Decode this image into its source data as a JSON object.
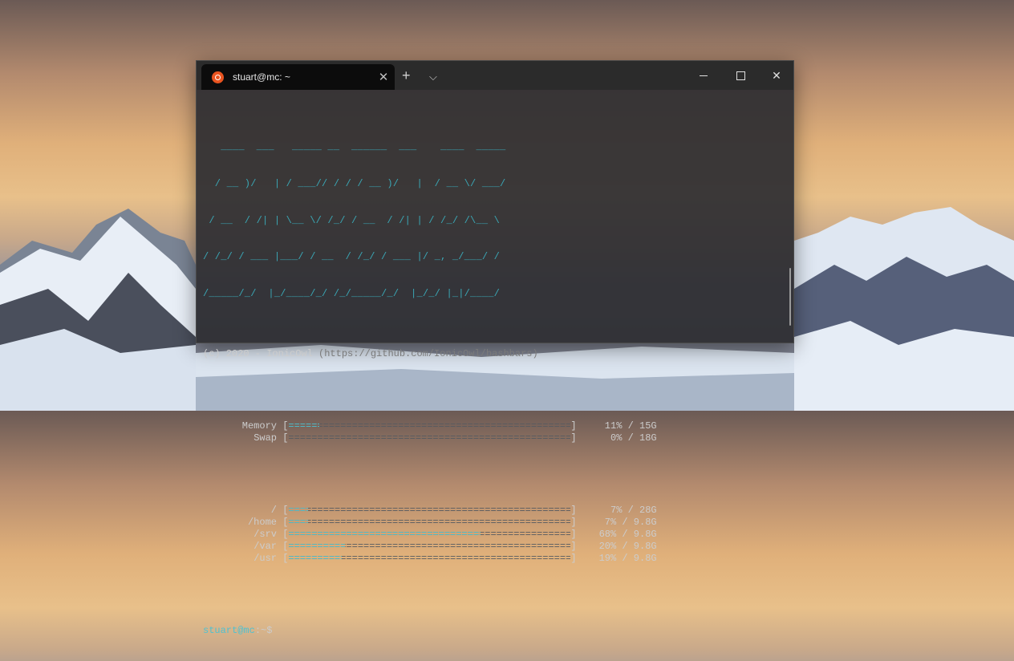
{
  "tab": {
    "title": "stuart@mc: ~",
    "icon": "ubuntu-icon",
    "accent": "#e95420"
  },
  "tab_controls": {
    "new_tab": "+",
    "dropdown": "⌵",
    "close": "✕"
  },
  "window_controls": {
    "close": "✕"
  },
  "banner": {
    "ascii": [
      "   ____  ___   _____ __  ______  ___    ____  _____",
      "  / __ )/   | / ___// / / / __ )/   |  / __ \\/ ___/",
      " / __  / /| | \\__ \\/ /_/ / __  / /| | / /_/ /\\__ \\ ",
      "/ /_/ / ___ |___/ / __  / /_/ / ___ |/ _, _/___/ / ",
      "/_____/_/  |_/____/_/ /_/_____/_/  |_/_/ |_|/____/  "
    ],
    "copyright": "(c) 2020 - IonicOwl",
    "url": "(https://github.com/IonicOwl/bashbars)"
  },
  "bars": {
    "memory": [
      {
        "label": "Memory",
        "percent": 11,
        "stat": "11% / 15G"
      },
      {
        "label": "Swap",
        "percent": 0,
        "stat": "0% / 18G"
      }
    ],
    "disks": [
      {
        "label": "/",
        "percent": 7,
        "stat": "7% / 28G"
      },
      {
        "label": "/home",
        "percent": 7,
        "stat": "7% / 9.8G"
      },
      {
        "label": "/srv",
        "percent": 68,
        "stat": "68% / 9.8G"
      },
      {
        "label": "/var",
        "percent": 20,
        "stat": "20% / 9.8G"
      },
      {
        "label": "/usr",
        "percent": 19,
        "stat": "19% / 9.8G"
      }
    ]
  },
  "prompt": {
    "user_host": "stuart@mc",
    "path": ":~",
    "symbol": "$"
  },
  "colors": {
    "bar_fill": "#4ec1d1",
    "bar_empty": "#555a60",
    "ascii": "#3aa6b4"
  }
}
